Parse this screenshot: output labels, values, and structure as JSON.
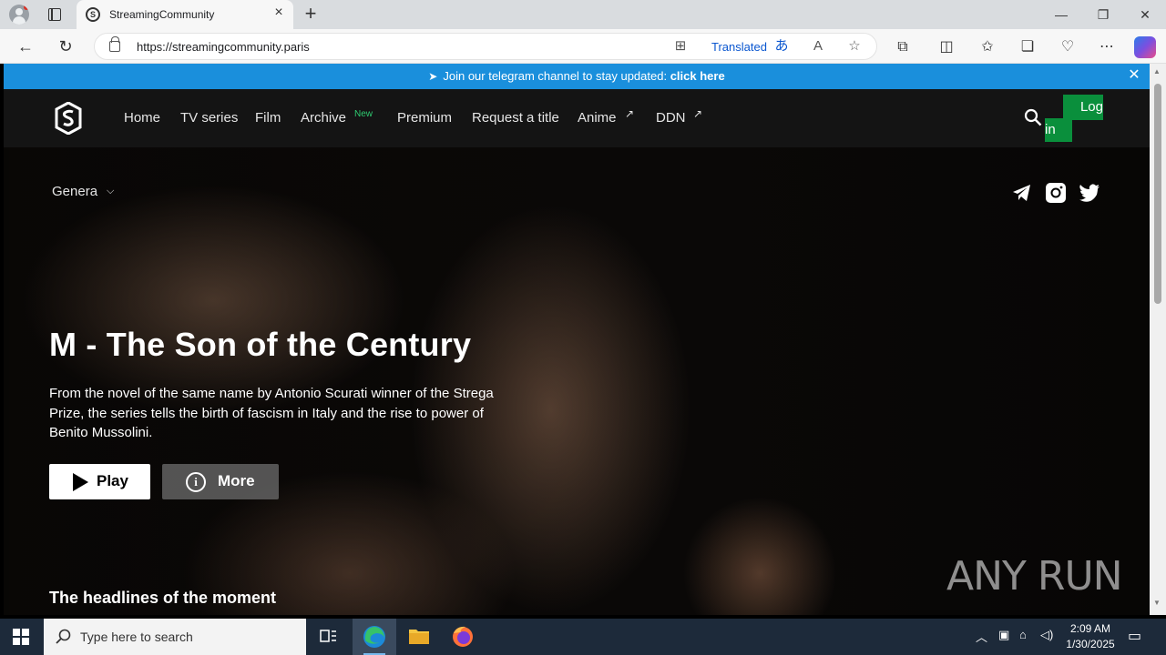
{
  "browser": {
    "tab_title": "StreamingCommunity",
    "url": "https://streamingcommunity.paris",
    "translated_label": "Translated"
  },
  "banner": {
    "text": "Join our telegram channel to stay updated:",
    "link": "click here"
  },
  "nav": {
    "items": [
      {
        "label": "Home"
      },
      {
        "label": "TV series"
      },
      {
        "label": "Film"
      },
      {
        "label": "Archive",
        "badge": "New"
      },
      {
        "label": "Premium"
      },
      {
        "label": "Request a title"
      },
      {
        "label": "Anime",
        "external": true
      },
      {
        "label": "DDN",
        "external": true
      }
    ],
    "login_a": "Log",
    "login_b": "in"
  },
  "filters": {
    "genera": "Genera"
  },
  "hero": {
    "title": "M - The Son of the Century",
    "description": "From the novel of the same name by Antonio Scurati winner of the Strega Prize, the series tells the birth of fascism in Italy and the rise to power of Benito Mussolini.",
    "play_label": "Play",
    "more_label": "More"
  },
  "section": {
    "headlines": "The headlines of the moment"
  },
  "watermark": "ANY RUN",
  "taskbar": {
    "search_placeholder": "Type here to search",
    "time": "2:09 AM",
    "date": "1/30/2025"
  },
  "colors": {
    "banner": "#1a8fdc",
    "login": "#0a8f3c",
    "new_badge": "#2ecc71"
  }
}
